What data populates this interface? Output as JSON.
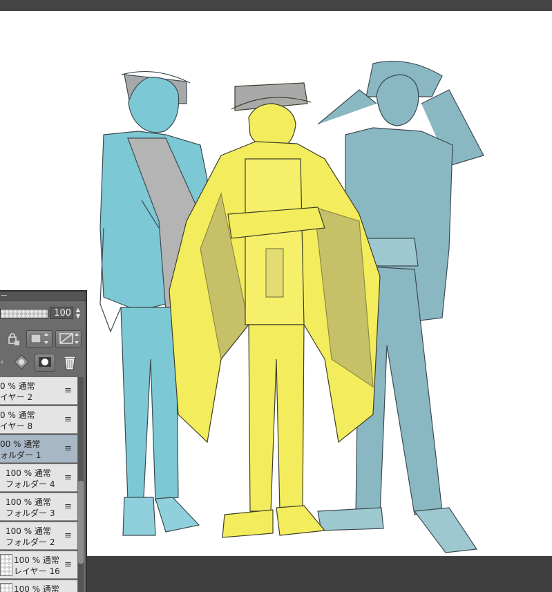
{
  "colors": {
    "accent_yellow": "#f3ec5c",
    "accent_cyan": "#7cc8d4",
    "accent_gray": "#a9a9a9",
    "selected_layer": "#a7b7c6"
  },
  "layer_panel": {
    "opacity_value": "100",
    "layers": [
      {
        "opacity_mode": "0 % 通常",
        "name": "イヤー 2",
        "selected": false
      },
      {
        "opacity_mode": "0 % 通常",
        "name": "イヤー 8",
        "selected": false
      },
      {
        "opacity_mode": "00 % 通常",
        "name": "ォルダー 1",
        "selected": true
      },
      {
        "opacity_mode": "100 % 通常",
        "name": "フォルダー 4",
        "selected": false
      },
      {
        "opacity_mode": "100 % 通常",
        "name": "フォルダー 3",
        "selected": false
      },
      {
        "opacity_mode": "100 % 通常",
        "name": "フォルダー 2",
        "selected": false
      },
      {
        "opacity_mode": "100 % 通常",
        "name": "レイヤー 16",
        "selected": false
      },
      {
        "opacity_mode": "100 % 通常",
        "name": "",
        "selected": false
      }
    ],
    "icons": [
      "lock-icon",
      "clip-icon",
      "reference-icon",
      "mask-icon",
      "trash-icon",
      "layer-menu-icon"
    ]
  }
}
